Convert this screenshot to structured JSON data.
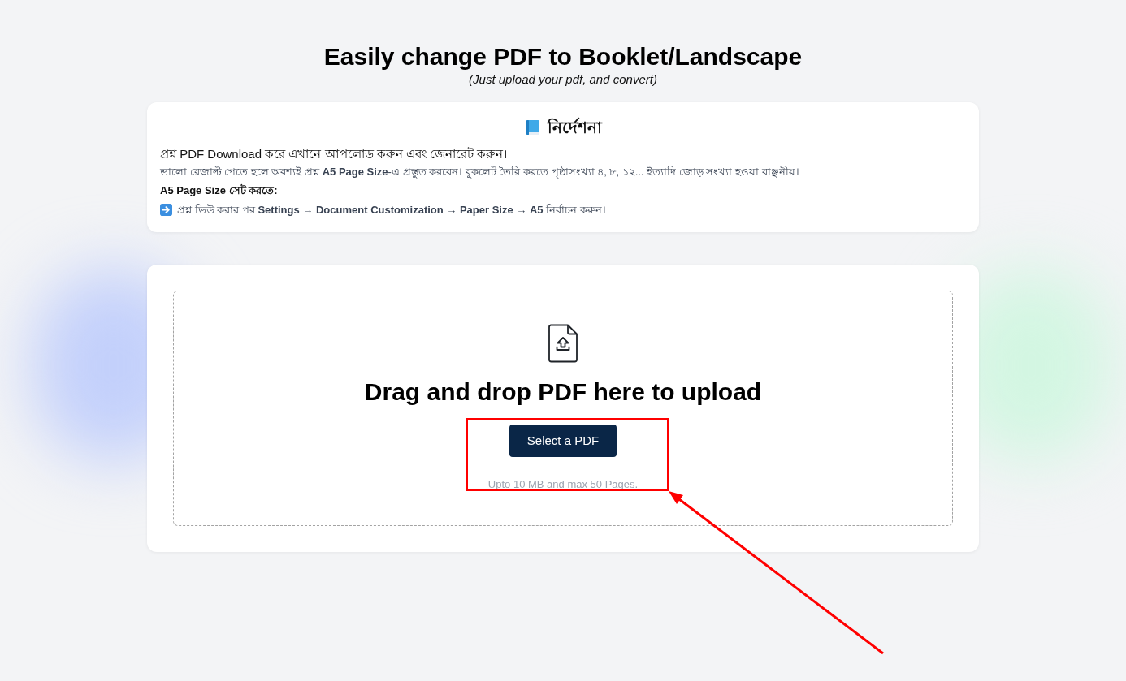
{
  "header": {
    "title": "Easily change PDF to Booklet/Landscape",
    "subtitle": "(Just upload your pdf, and convert)"
  },
  "instructions": {
    "heading": "নির্দেশনা",
    "lines": [
      {
        "kind": "lead",
        "text": "প্রশ্ন PDF Download করে এখানে আপলোড করুন এবং জেনারেট করুন।"
      },
      {
        "kind": "note",
        "text": "ভালো রেজাল্ট পেতে হলে অবশ্যই প্রশ্ন **A5 Page Size**-এ প্রস্তুত করবেন। বুকলেট তৈরি করতে পৃষ্ঠাসংখ্যা ৪, ৮, ১২... ইত্যাদি জোড় সংখ্যা হওয়া বাঞ্ছনীয়।"
      },
      {
        "kind": "subheading",
        "text": "A5 Page Size সেট করতে:"
      },
      {
        "kind": "step",
        "text": "প্রশ্ন ভিউ করার পর **Settings** → **Document Customization** → **Paper Size** → **A5** নির্বাচন করুন।"
      }
    ]
  },
  "upload": {
    "heading": "Drag and drop PDF here to upload",
    "button": "Select a PDF",
    "note": "Upto 10 MB and max 50 Pages."
  },
  "annotation": {
    "highlight_box": true,
    "arrow": true
  }
}
